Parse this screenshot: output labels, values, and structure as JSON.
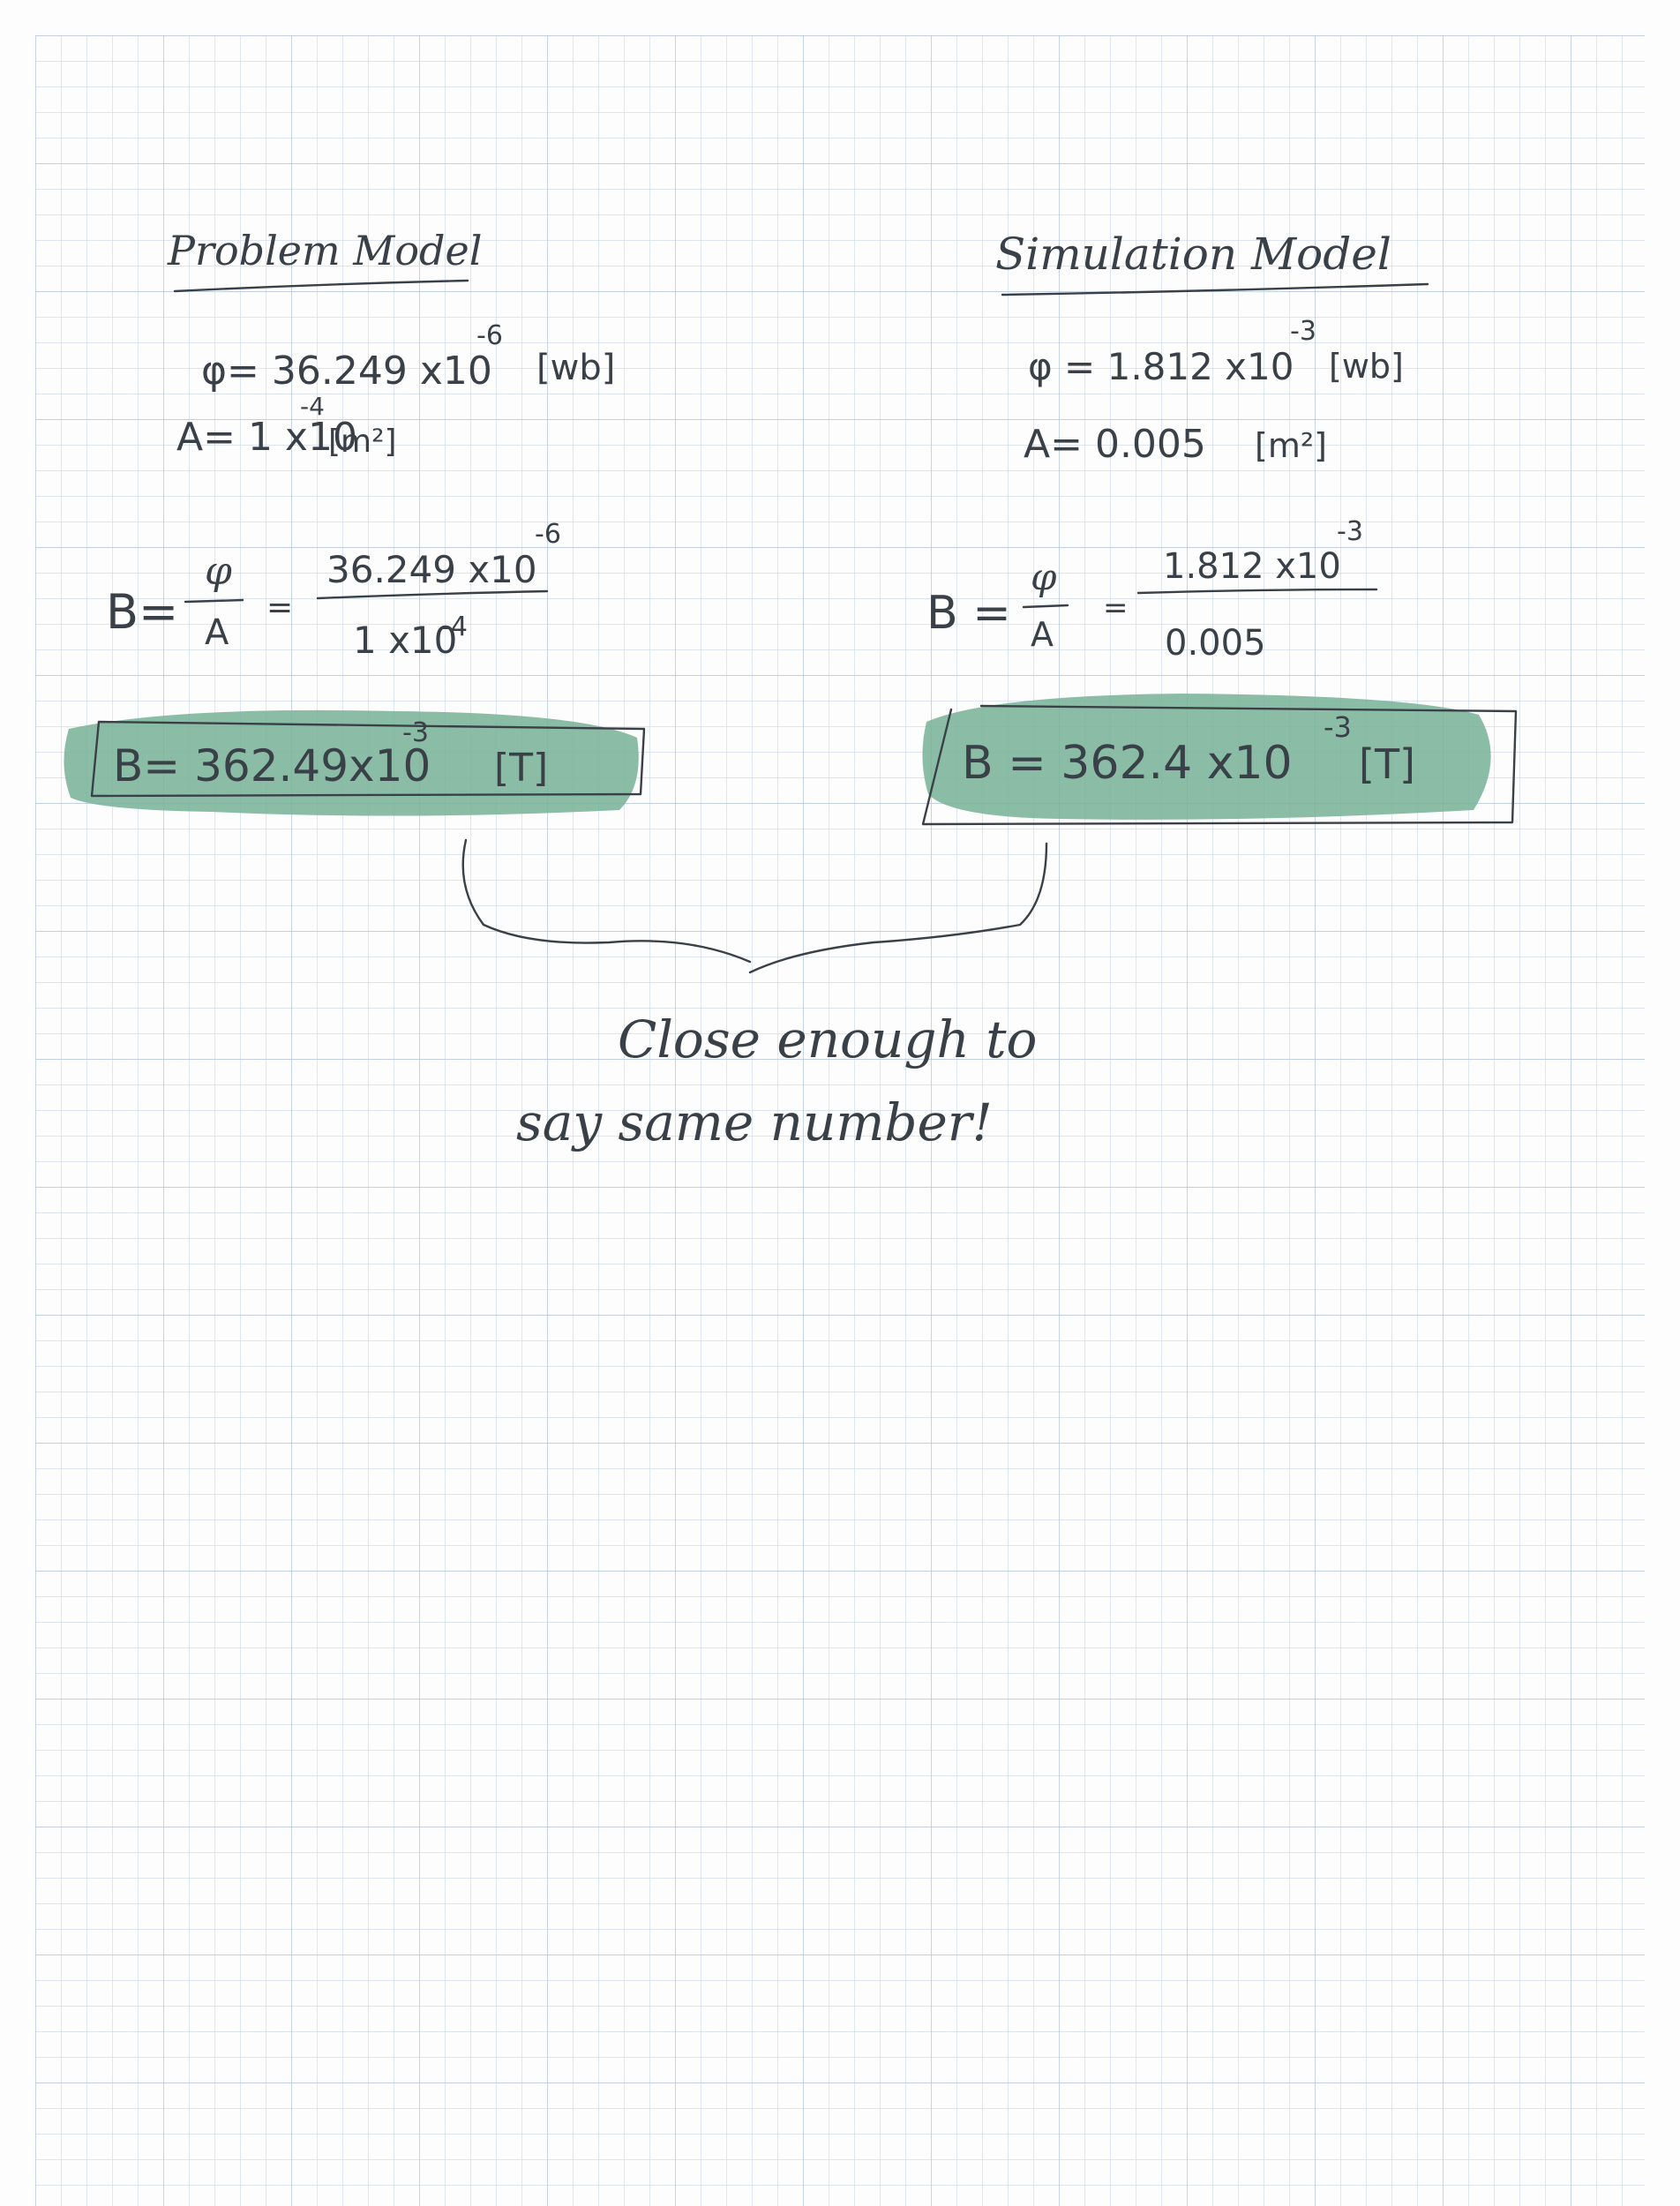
{
  "left": {
    "title": "Problem Model",
    "phi_line": "φ= 36.249 x10",
    "phi_exp": "-6",
    "phi_unit": "[wb]",
    "area_line": "A= 1 x10",
    "area_exp": "-4",
    "area_unit": "[m²]",
    "b_lhs": "B=",
    "frac_num": "φ",
    "frac_den": "A",
    "eq": "=",
    "num_value": "36.249 x10",
    "num_exp": "-6",
    "den_value": "1 x10",
    "den_exp": "-4",
    "result_text": "B= 362.49x10",
    "result_exp": "-3",
    "result_unit": "[T]"
  },
  "right": {
    "title": "Simulation Model",
    "phi_line": "φ = 1.812 x10",
    "phi_exp": "-3",
    "phi_unit": "[wb]",
    "area_line": "A= 0.005",
    "area_unit": "[m²]",
    "b_lhs": "B =",
    "frac_num": "φ",
    "frac_den": "A",
    "eq": "=",
    "num_value": "1.812 x10",
    "num_exp": "-3",
    "den_value": "0.005",
    "result_text": "B = 362.4 x10",
    "result_exp": "-3",
    "result_unit": "[T]"
  },
  "note": {
    "line1": "Close enough to",
    "line2": "say same number!"
  },
  "colors": {
    "ink": "#3a4047",
    "highlight": "#77b296",
    "grid_minor": "#c9d6ea",
    "grid_major": "#a9bcd9"
  }
}
